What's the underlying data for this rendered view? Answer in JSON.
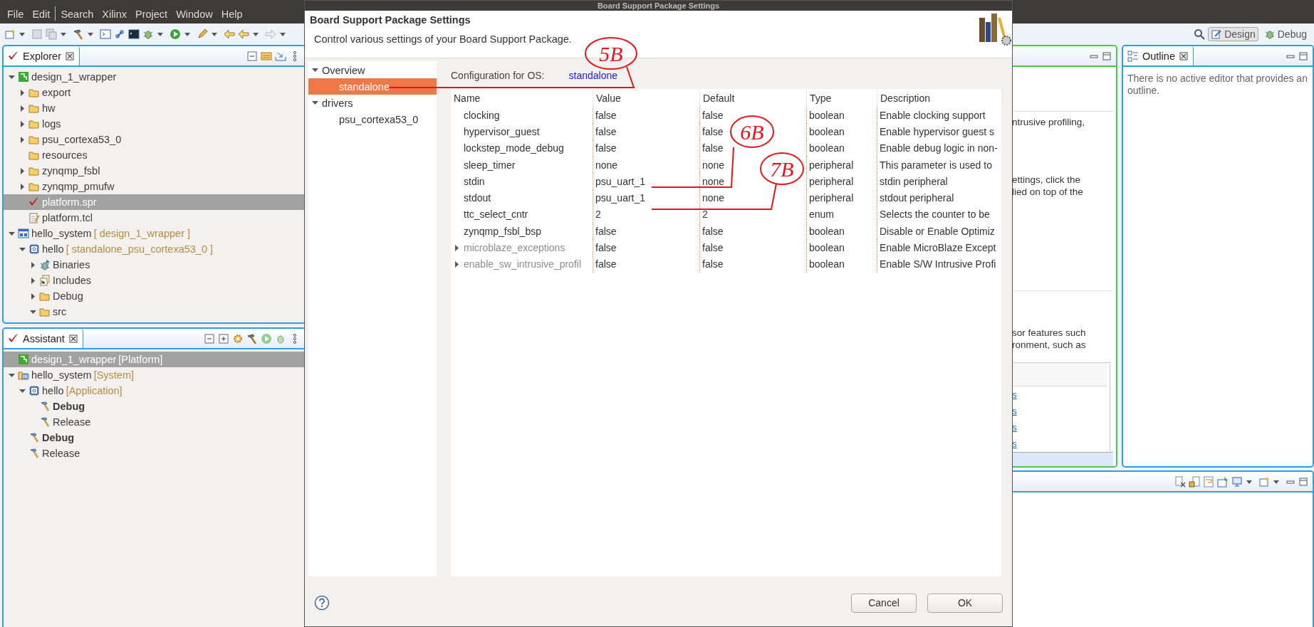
{
  "menu": [
    "File",
    "Edit",
    "Search",
    "Xilinx",
    "Project",
    "Window",
    "Help"
  ],
  "perspectives": [
    {
      "label": "Design",
      "selected": true
    },
    {
      "label": "Debug",
      "selected": false
    }
  ],
  "explorer": {
    "title": "Explorer",
    "tree": [
      {
        "label": "design_1_wrapper",
        "kind": "platform",
        "expanded": true,
        "selected": false,
        "children": [
          {
            "label": "export",
            "kind": "folder",
            "expanded": false,
            "selected": false
          },
          {
            "label": "hw",
            "kind": "folder",
            "expanded": false,
            "selected": false
          },
          {
            "label": "logs",
            "kind": "folder",
            "expanded": false,
            "selected": false
          },
          {
            "label": "psu_cortexa53_0",
            "kind": "folder",
            "expanded": false,
            "selected": false
          },
          {
            "label": "resources",
            "kind": "folder",
            "selected": false
          },
          {
            "label": "zynqmp_fsbl",
            "kind": "folder",
            "expanded": false,
            "selected": false
          },
          {
            "label": "zynqmp_pmufw",
            "kind": "folder",
            "expanded": false,
            "selected": false
          },
          {
            "label": "platform.spr",
            "kind": "spr",
            "selected": true
          },
          {
            "label": "platform.tcl",
            "kind": "tcl",
            "selected": false
          }
        ]
      },
      {
        "label": "hello_system",
        "tag": "[ design_1_wrapper ]",
        "kind": "system",
        "expanded": true,
        "selected": false,
        "children": [
          {
            "label": "hello",
            "tag": "[ standalone_psu_cortexa53_0 ]",
            "kind": "app",
            "expanded": true,
            "selected": false,
            "children": [
              {
                "label": "Binaries",
                "kind": "binaries",
                "expanded": false,
                "selected": false
              },
              {
                "label": "Includes",
                "kind": "includes",
                "expanded": false,
                "selected": false
              },
              {
                "label": "Debug",
                "kind": "folder",
                "expanded": false,
                "selected": false
              },
              {
                "label": "src",
                "kind": "folder",
                "expanded": true,
                "selected": false
              }
            ]
          }
        ]
      }
    ]
  },
  "assistant": {
    "title": "Assistant",
    "tree": [
      {
        "label": "design_1_wrapper",
        "tag": "[Platform]",
        "kind": "platform",
        "selected": true
      },
      {
        "label": "hello_system",
        "tag": "[System]",
        "kind": "sysfolder",
        "expanded": true,
        "selected": false,
        "children": [
          {
            "label": "hello",
            "tag": "[Application]",
            "kind": "app",
            "expanded": true,
            "selected": false,
            "children": [
              {
                "label": "Debug",
                "kind": "build",
                "active": true,
                "selected": false
              },
              {
                "label": "Release",
                "kind": "build",
                "active": false,
                "selected": false
              }
            ]
          },
          {
            "label": "Debug",
            "kind": "build",
            "active": true,
            "selected": false
          },
          {
            "label": "Release",
            "kind": "build",
            "active": false,
            "selected": false
          }
        ]
      }
    ]
  },
  "editor": {
    "lines": [
      "ntrusive profiling,",
      "ettings, click the",
      "lied on top of the",
      "sor features such",
      "ronment, such as"
    ],
    "links": [
      "s",
      "s",
      "s",
      "s"
    ]
  },
  "outline": {
    "title": "Outline",
    "message": "There is no active editor that provides an outline."
  },
  "dialog": {
    "title": "Board Support Package Settings",
    "heading": "Board Support Package Settings",
    "subtitle": "Control various settings of your Board Support Package.",
    "nav": [
      {
        "label": "Overview",
        "expanded": true,
        "selected": false,
        "children": [
          {
            "label": "standalone",
            "selected": true
          }
        ]
      },
      {
        "label": "drivers",
        "expanded": true,
        "selected": false,
        "children": [
          {
            "label": "psu_cortexa53_0",
            "selected": false
          }
        ]
      }
    ],
    "config_label": "Configuration for OS:",
    "config_os": "standalone",
    "table": {
      "columns": [
        "Name",
        "Value",
        "Default",
        "Type",
        "Description"
      ],
      "rows": [
        {
          "name": "clocking",
          "value": "false",
          "default": "false",
          "type": "boolean",
          "description": "Enable clocking support",
          "disabled": false
        },
        {
          "name": "hypervisor_guest",
          "value": "false",
          "default": "false",
          "type": "boolean",
          "description": "Enable hypervisor guest s",
          "disabled": false
        },
        {
          "name": "lockstep_mode_debug",
          "value": "false",
          "default": "false",
          "type": "boolean",
          "description": "Enable debug logic in non-",
          "disabled": false
        },
        {
          "name": "sleep_timer",
          "value": "none",
          "default": "none",
          "type": "peripheral",
          "description": "This parameter is used to",
          "disabled": false
        },
        {
          "name": "stdin",
          "value": "psu_uart_1",
          "default": "none",
          "type": "peripheral",
          "description": "stdin peripheral",
          "disabled": false
        },
        {
          "name": "stdout",
          "value": "psu_uart_1",
          "default": "none",
          "type": "peripheral",
          "description": "stdout peripheral",
          "disabled": false
        },
        {
          "name": "ttc_select_cntr",
          "value": "2",
          "default": "2",
          "type": "enum",
          "description": "Selects the counter to be",
          "disabled": false
        },
        {
          "name": "zynqmp_fsbl_bsp",
          "value": "false",
          "default": "false",
          "type": "boolean",
          "description": "Disable or Enable Optimiz",
          "disabled": false
        },
        {
          "name": "microblaze_exceptions",
          "value": "false",
          "default": "false",
          "type": "boolean",
          "description": "Enable MicroBlaze Except",
          "disabled": true,
          "expanded": false
        },
        {
          "name": "enable_sw_intrusive_profil",
          "value": "false",
          "default": "false",
          "type": "boolean",
          "description": "Enable S/W Intrusive Profi",
          "disabled": true,
          "expanded": false
        }
      ]
    },
    "buttons": [
      "Cancel",
      "OK"
    ]
  },
  "annotations": [
    {
      "text": "5B"
    },
    {
      "text": "6B"
    },
    {
      "text": "7B"
    }
  ]
}
